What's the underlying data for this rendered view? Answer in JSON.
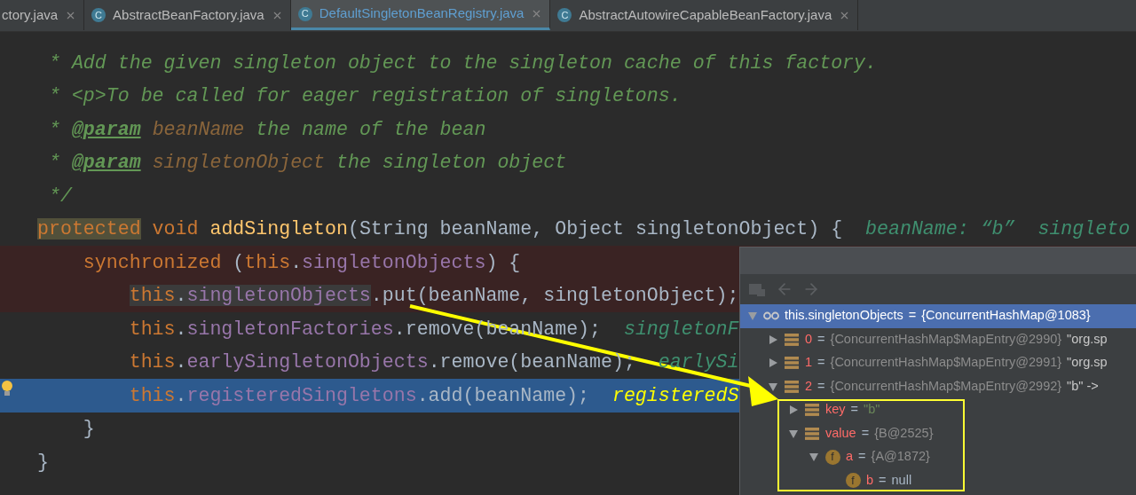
{
  "tabs": [
    {
      "label": "ctory.java",
      "selected": false
    },
    {
      "label": "AbstractBeanFactory.java",
      "selected": false,
      "icon_letter": "C"
    },
    {
      "label": "DefaultSingletonBeanRegistry.java",
      "selected": true,
      "icon_letter": "C"
    },
    {
      "label": "AbstractAutowireCapableBeanFactory.java",
      "selected": false,
      "icon_letter": "C"
    }
  ],
  "code_lines": [
    {
      "breakpoint_hit": false,
      "execution_point": false,
      "tokens": [
        {
          "kind": "comment",
          "text": " * Add the given singleton object to the singleton cache of this factory."
        }
      ]
    },
    {
      "breakpoint_hit": false,
      "execution_point": false,
      "tokens": [
        {
          "kind": "comment",
          "text": " * "
        },
        {
          "kind": "tag",
          "text": "<p>"
        },
        {
          "kind": "comment",
          "text": "To be called for eager registration of singletons."
        }
      ]
    },
    {
      "breakpoint_hit": false,
      "execution_point": false,
      "tokens": [
        {
          "kind": "comment",
          "text": " * "
        },
        {
          "kind": "doctag",
          "text": "@param"
        },
        {
          "kind": "param",
          "text": " beanName"
        },
        {
          "kind": "comment",
          "text": " the name of the bean"
        }
      ]
    },
    {
      "breakpoint_hit": false,
      "execution_point": false,
      "tokens": [
        {
          "kind": "comment",
          "text": " * "
        },
        {
          "kind": "doctag",
          "text": "@param"
        },
        {
          "kind": "param",
          "text": " singletonObject"
        },
        {
          "kind": "comment",
          "text": " the singleton object"
        }
      ]
    },
    {
      "breakpoint_hit": false,
      "execution_point": false,
      "tokens": [
        {
          "kind": "comment",
          "text": " */"
        }
      ]
    },
    {
      "breakpoint_hit": false,
      "execution_point": false,
      "tokens": [
        {
          "kind": "keyword-marked",
          "text": "protected"
        },
        {
          "kind": "keyword",
          "text": " void"
        },
        {
          "kind": "method",
          "text": " addSingleton"
        },
        {
          "kind": "plain",
          "text": "(String beanName, Object singletonObject) {  "
        },
        {
          "kind": "hint",
          "text": "beanName: “b”  singleto"
        }
      ]
    },
    {
      "breakpoint_hit": true,
      "execution_point": false,
      "tokens": [
        {
          "kind": "keyword",
          "text": "    synchronized"
        },
        {
          "kind": "plain",
          "text": " ("
        },
        {
          "kind": "keyword",
          "text": "this"
        },
        {
          "kind": "plain",
          "text": "."
        },
        {
          "kind": "field",
          "text": "singletonObjects"
        },
        {
          "kind": "plain",
          "text": ") {"
        }
      ]
    },
    {
      "breakpoint_hit": true,
      "execution_point": false,
      "tokens": [
        {
          "kind": "keyword-selected",
          "text": "        this"
        },
        {
          "kind": "plain-selected",
          "text": "."
        },
        {
          "kind": "field-selected",
          "text": "singletonObjects"
        },
        {
          "kind": "plain",
          "text": ".put(beanName, singletonObject);"
        }
      ]
    },
    {
      "breakpoint_hit": false,
      "execution_point": false,
      "tokens": [
        {
          "kind": "keyword",
          "text": "        this"
        },
        {
          "kind": "plain",
          "text": "."
        },
        {
          "kind": "field",
          "text": "singletonFactories"
        },
        {
          "kind": "plain",
          "text": ".remove(beanName);  "
        },
        {
          "kind": "hint",
          "text": "singletonF"
        }
      ]
    },
    {
      "breakpoint_hit": false,
      "execution_point": false,
      "tokens": [
        {
          "kind": "keyword",
          "text": "        this"
        },
        {
          "kind": "plain",
          "text": "."
        },
        {
          "kind": "field",
          "text": "earlySingletonObjects"
        },
        {
          "kind": "plain",
          "text": ".remove(beanName);  "
        },
        {
          "kind": "hint",
          "text": "earlySi"
        }
      ]
    },
    {
      "breakpoint_hit": false,
      "execution_point": true,
      "tokens": [
        {
          "kind": "keyword",
          "text": "        this"
        },
        {
          "kind": "plain",
          "text": "."
        },
        {
          "kind": "field",
          "text": "registeredSingletons"
        },
        {
          "kind": "plain",
          "text": ".add(beanName);  "
        },
        {
          "kind": "hint-current",
          "text": "registeredS"
        }
      ]
    },
    {
      "breakpoint_hit": false,
      "execution_point": false,
      "tokens": [
        {
          "kind": "plain",
          "text": "    }"
        }
      ]
    },
    {
      "breakpoint_hit": false,
      "execution_point": false,
      "tokens": [
        {
          "kind": "plain",
          "text": "}"
        }
      ]
    }
  ],
  "variables": {
    "tree": [
      {
        "kind": "watch",
        "name": "this.singletonObjects",
        "equals": "=",
        "value": "{ConcurrentHashMap@1083}",
        "selected": true,
        "expanded": true,
        "children": [
          {
            "kind": "entry",
            "name": "0",
            "equals": "=",
            "value": "{ConcurrentHashMap$MapEntry@2990}",
            "extra": "\"org.sp",
            "selected": false,
            "expanded": false
          },
          {
            "kind": "entry",
            "name": "1",
            "equals": "=",
            "value": "{ConcurrentHashMap$MapEntry@2991}",
            "extra": "\"org.sp",
            "selected": false,
            "expanded": false
          },
          {
            "kind": "entry",
            "name": "2",
            "equals": "=",
            "value": "{ConcurrentHashMap$MapEntry@2992}",
            "extra": "\"b\" ->",
            "selected": false,
            "expanded": true,
            "children": [
              {
                "kind": "entry",
                "name": "key",
                "equals": "=",
                "value": "\"b\"",
                "is_string": true,
                "selected": false,
                "expanded": false
              },
              {
                "kind": "entry",
                "name": "value",
                "equals": "=",
                "value": "{B@2525}",
                "selected": false,
                "expanded": true,
                "children": [
                  {
                    "kind": "field",
                    "icon_letter": "f",
                    "name": "a",
                    "equals": "=",
                    "value": "{A@1872}",
                    "selected": false,
                    "expanded": true,
                    "children": [
                      {
                        "kind": "field",
                        "icon_letter": "f",
                        "name": "b",
                        "equals": "=",
                        "value": "null",
                        "is_null": true,
                        "selected": false
                      }
                    ]
                  }
                ]
              }
            ]
          }
        ]
      }
    ]
  }
}
